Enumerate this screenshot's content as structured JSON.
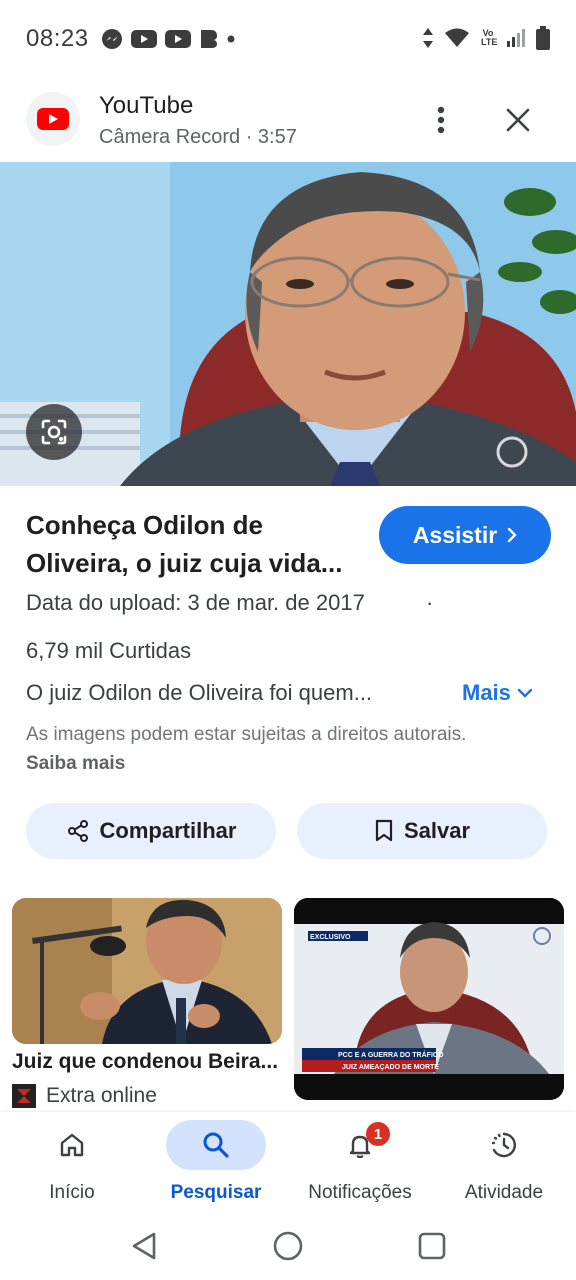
{
  "status_bar": {
    "time": "08:23",
    "left_icons": [
      "messenger-icon",
      "youtube-icon",
      "youtube-icon",
      "b-app-icon",
      "dot-icon"
    ],
    "right_icons": [
      "data-arrows-icon",
      "wifi-icon",
      "volte-icon",
      "signal-icon",
      "battery-icon"
    ],
    "volte_text": "Vo LTE"
  },
  "header": {
    "app_name": "YouTube",
    "subtitle": "Câmera Record · 3:57"
  },
  "video": {
    "title": "Conheça Odilon de Oliveira, o juiz cuja vida...",
    "watch_label": "Assistir",
    "upload_date": "Data do upload: 3 de mar. de 2017",
    "upload_sep": "·",
    "likes": "6,79 mil Curtidas",
    "description": "O juiz Odilon de Oliveira foi quem...",
    "more_label": "Mais",
    "copyright_text": "As imagens podem estar sujeitas a direitos autorais.",
    "copyright_link": "Saiba mais"
  },
  "actions": {
    "share_label": "Compartilhar",
    "save_label": "Salvar"
  },
  "related": [
    {
      "title": "Juiz que condenou Beira...",
      "source": "Extra online"
    },
    {
      "title": "",
      "source": "",
      "banner_top": "EXCLUSIVO",
      "banner_line1": "PCC E A GUERRA DO TRÁFICO",
      "banner_line2": "JUIZ AMEAÇADO DE MORTE"
    }
  ],
  "bottom_nav": [
    {
      "label": "Início",
      "icon": "home-icon",
      "active": false
    },
    {
      "label": "Pesquisar",
      "icon": "search-icon",
      "active": true
    },
    {
      "label": "Notificações",
      "icon": "bell-icon",
      "active": false,
      "badge": "1"
    },
    {
      "label": "Atividade",
      "icon": "activity-icon",
      "active": false
    }
  ],
  "colors": {
    "accent": "#1a73e8",
    "chip_bg": "#e8f0fe",
    "active_nav_bg": "#d3e3fd",
    "badge": "#d93025",
    "youtube_red": "#ff0000"
  }
}
